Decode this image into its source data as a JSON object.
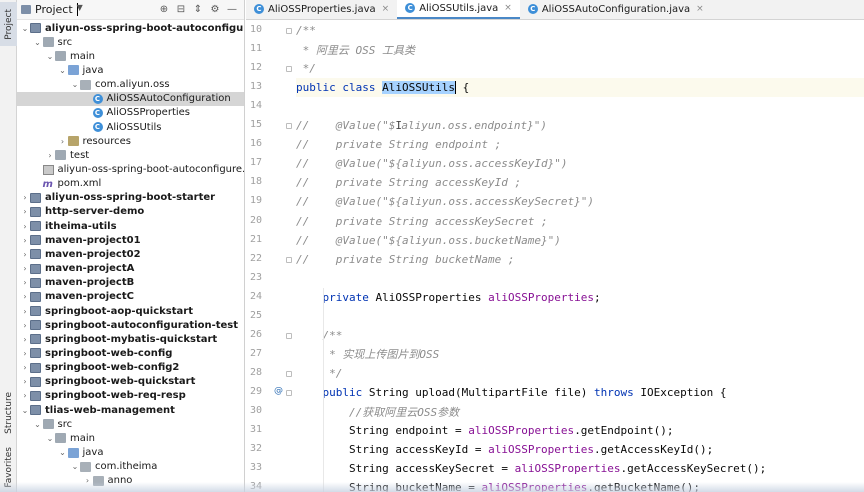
{
  "toolstrip": {
    "project_tab": "Project",
    "structure_tab": "Structure",
    "favorites_tab": "Favorites"
  },
  "project_panel": {
    "title": "Project",
    "tree": [
      {
        "label": "aliyun-oss-spring-boot-autoconfigure",
        "indent": 0,
        "arrow": "down",
        "icon": "module",
        "bold": true
      },
      {
        "label": "src",
        "indent": 1,
        "arrow": "down",
        "icon": "folder-plain"
      },
      {
        "label": "main",
        "indent": 2,
        "arrow": "down",
        "icon": "folder-plain"
      },
      {
        "label": "java",
        "indent": 3,
        "arrow": "down",
        "icon": "folder-src"
      },
      {
        "label": "com.aliyun.oss",
        "indent": 4,
        "arrow": "down",
        "icon": "package"
      },
      {
        "label": "AliOSSAutoConfiguration",
        "indent": 5,
        "arrow": "",
        "icon": "class",
        "selected": true
      },
      {
        "label": "AliOSSProperties",
        "indent": 5,
        "arrow": "",
        "icon": "class"
      },
      {
        "label": "AliOSSUtils",
        "indent": 5,
        "arrow": "",
        "icon": "class"
      },
      {
        "label": "resources",
        "indent": 3,
        "arrow": "right",
        "icon": "folder-res"
      },
      {
        "label": "test",
        "indent": 2,
        "arrow": "right",
        "icon": "folder-plain"
      },
      {
        "label": "aliyun-oss-spring-boot-autoconfigure.iml",
        "indent": 1,
        "arrow": "",
        "icon": "iml"
      },
      {
        "label": "pom.xml",
        "indent": 1,
        "arrow": "",
        "icon": "pom"
      },
      {
        "label": "aliyun-oss-spring-boot-starter",
        "indent": 0,
        "arrow": "right",
        "icon": "module",
        "bold": true
      },
      {
        "label": "http-server-demo",
        "indent": 0,
        "arrow": "right",
        "icon": "module",
        "bold": true
      },
      {
        "label": "itheima-utils",
        "indent": 0,
        "arrow": "right",
        "icon": "module",
        "bold": true
      },
      {
        "label": "maven-project01",
        "indent": 0,
        "arrow": "right",
        "icon": "module",
        "bold": true
      },
      {
        "label": "maven-project02",
        "indent": 0,
        "arrow": "right",
        "icon": "module",
        "bold": true
      },
      {
        "label": "maven-projectA",
        "indent": 0,
        "arrow": "right",
        "icon": "module",
        "bold": true
      },
      {
        "label": "maven-projectB",
        "indent": 0,
        "arrow": "right",
        "icon": "module",
        "bold": true
      },
      {
        "label": "maven-projectC",
        "indent": 0,
        "arrow": "right",
        "icon": "module",
        "bold": true
      },
      {
        "label": "springboot-aop-quickstart",
        "indent": 0,
        "arrow": "right",
        "icon": "module",
        "bold": true
      },
      {
        "label": "springboot-autoconfiguration-test",
        "indent": 0,
        "arrow": "right",
        "icon": "module",
        "bold": true
      },
      {
        "label": "springboot-mybatis-quickstart",
        "indent": 0,
        "arrow": "right",
        "icon": "module",
        "bold": true
      },
      {
        "label": "springboot-web-config",
        "indent": 0,
        "arrow": "right",
        "icon": "module",
        "bold": true
      },
      {
        "label": "springboot-web-config2",
        "indent": 0,
        "arrow": "right",
        "icon": "module",
        "bold": true
      },
      {
        "label": "springboot-web-quickstart",
        "indent": 0,
        "arrow": "right",
        "icon": "module",
        "bold": true
      },
      {
        "label": "springboot-web-req-resp",
        "indent": 0,
        "arrow": "right",
        "icon": "module",
        "bold": true
      },
      {
        "label": "tlias-web-management",
        "indent": 0,
        "arrow": "down",
        "icon": "module",
        "bold": true
      },
      {
        "label": "src",
        "indent": 1,
        "arrow": "down",
        "icon": "folder-plain"
      },
      {
        "label": "main",
        "indent": 2,
        "arrow": "down",
        "icon": "folder-plain"
      },
      {
        "label": "java",
        "indent": 3,
        "arrow": "down",
        "icon": "folder-src"
      },
      {
        "label": "com.itheima",
        "indent": 4,
        "arrow": "down",
        "icon": "package"
      },
      {
        "label": "anno",
        "indent": 5,
        "arrow": "right",
        "icon": "package"
      }
    ]
  },
  "editor": {
    "tabs": [
      {
        "label": "AliOSSProperties.java",
        "active": false
      },
      {
        "label": "AliOSSUtils.java",
        "active": true
      },
      {
        "label": "AliOSSAutoConfiguration.java",
        "active": false
      }
    ],
    "lines": [
      {
        "num": "10",
        "fold": true,
        "indent": 0,
        "segments": [
          {
            "t": "/**",
            "c": "cmt"
          }
        ]
      },
      {
        "num": "11",
        "indent": 0,
        "segments": [
          {
            "t": " * 阿里云 OSS 工具类",
            "c": "cmt"
          }
        ]
      },
      {
        "num": "12",
        "fold": true,
        "indent": 0,
        "segments": [
          {
            "t": " */",
            "c": "cmt"
          }
        ]
      },
      {
        "num": "13",
        "current": true,
        "indent": 0,
        "segments": [
          {
            "t": "public class ",
            "c": "kw"
          },
          {
            "t": "AliOSSUtils",
            "c": "plain hl"
          },
          {
            "t": "CARET",
            "c": "caret"
          },
          {
            "t": " {",
            "c": "plain"
          }
        ]
      },
      {
        "num": "14",
        "indent": 0,
        "segments": []
      },
      {
        "num": "15",
        "fold": true,
        "indent": 0,
        "segments": [
          {
            "t": "//    @Value(\"$",
            "c": "cmt"
          },
          {
            "t": "I",
            "c": "cmt cursor-i"
          },
          {
            "t": "aliyun.oss.endpoint}\")",
            "c": "cmt"
          }
        ]
      },
      {
        "num": "16",
        "indent": 0,
        "segments": [
          {
            "t": "//    private String endpoint ;",
            "c": "cmt"
          }
        ]
      },
      {
        "num": "17",
        "indent": 0,
        "segments": [
          {
            "t": "//    @Value(\"${aliyun.oss.accessKeyId}\")",
            "c": "cmt"
          }
        ]
      },
      {
        "num": "18",
        "indent": 0,
        "segments": [
          {
            "t": "//    private String accessKeyId ;",
            "c": "cmt"
          }
        ]
      },
      {
        "num": "19",
        "indent": 0,
        "segments": [
          {
            "t": "//    @Value(\"${aliyun.oss.accessKeySecret}\")",
            "c": "cmt"
          }
        ]
      },
      {
        "num": "20",
        "indent": 0,
        "segments": [
          {
            "t": "//    private String accessKeySecret ;",
            "c": "cmt"
          }
        ]
      },
      {
        "num": "21",
        "indent": 0,
        "segments": [
          {
            "t": "//    @Value(\"${aliyun.oss.bucketName}\")",
            "c": "cmt"
          }
        ]
      },
      {
        "num": "22",
        "fold": true,
        "indent": 0,
        "segments": [
          {
            "t": "//    private String bucketName ;",
            "c": "cmt"
          }
        ]
      },
      {
        "num": "23",
        "indent": 0,
        "segments": []
      },
      {
        "num": "24",
        "indent": 1,
        "segments": [
          {
            "t": "private ",
            "c": "kw"
          },
          {
            "t": "AliOSSProperties ",
            "c": "plain"
          },
          {
            "t": "aliOSSProperties",
            "c": "fld"
          },
          {
            "t": ";",
            "c": "plain"
          }
        ]
      },
      {
        "num": "25",
        "indent": 0,
        "segments": []
      },
      {
        "num": "26",
        "fold": true,
        "indent": 1,
        "segments": [
          {
            "t": "/**",
            "c": "cmt"
          }
        ]
      },
      {
        "num": "27",
        "indent": 1,
        "segments": [
          {
            "t": " * 实现上传图片到OSS",
            "c": "cmt"
          }
        ]
      },
      {
        "num": "28",
        "fold": true,
        "indent": 1,
        "segments": [
          {
            "t": " */",
            "c": "cmt"
          }
        ]
      },
      {
        "num": "29",
        "marker": "@",
        "fold": true,
        "indent": 1,
        "segments": [
          {
            "t": "public ",
            "c": "kw"
          },
          {
            "t": "String ",
            "c": "plain"
          },
          {
            "t": "upload",
            "c": "plain"
          },
          {
            "t": "(MultipartFile file) ",
            "c": "plain"
          },
          {
            "t": "throws ",
            "c": "kw"
          },
          {
            "t": "IOException {",
            "c": "plain"
          }
        ]
      },
      {
        "num": "30",
        "indent": 2,
        "segments": [
          {
            "t": "//获取阿里云OSS参数",
            "c": "cmt"
          }
        ]
      },
      {
        "num": "31",
        "indent": 2,
        "segments": [
          {
            "t": "String endpoint = ",
            "c": "plain"
          },
          {
            "t": "aliOSSProperties",
            "c": "fld"
          },
          {
            "t": ".getEndpoint();",
            "c": "plain"
          }
        ]
      },
      {
        "num": "32",
        "indent": 2,
        "segments": [
          {
            "t": "String accessKeyId = ",
            "c": "plain"
          },
          {
            "t": "aliOSSProperties",
            "c": "fld"
          },
          {
            "t": ".getAccessKeyId();",
            "c": "plain"
          }
        ]
      },
      {
        "num": "33",
        "indent": 2,
        "segments": [
          {
            "t": "String accessKeySecret = ",
            "c": "plain"
          },
          {
            "t": "aliOSSProperties",
            "c": "fld"
          },
          {
            "t": ".getAccessKeySecret();",
            "c": "plain"
          }
        ]
      },
      {
        "num": "34",
        "indent": 2,
        "segments": [
          {
            "t": "String bucketName = ",
            "c": "plain"
          },
          {
            "t": "aliOSSProperties",
            "c": "fld"
          },
          {
            "t": ".getBucketName();",
            "c": "plain"
          }
        ]
      }
    ]
  },
  "colors": {
    "keyword": "#0033b3",
    "field": "#871094",
    "comment": "#8c8c8c",
    "selection": "#a6d2ff",
    "class_icon": "#3e8fd8",
    "active_tab_underline": "#4a88c7"
  },
  "icons": {
    "project_header": [
      "target-icon",
      "collapse-all-icon",
      "expand-icon",
      "gear-icon",
      "minimize-icon"
    ],
    "tab_close": "close-icon"
  }
}
